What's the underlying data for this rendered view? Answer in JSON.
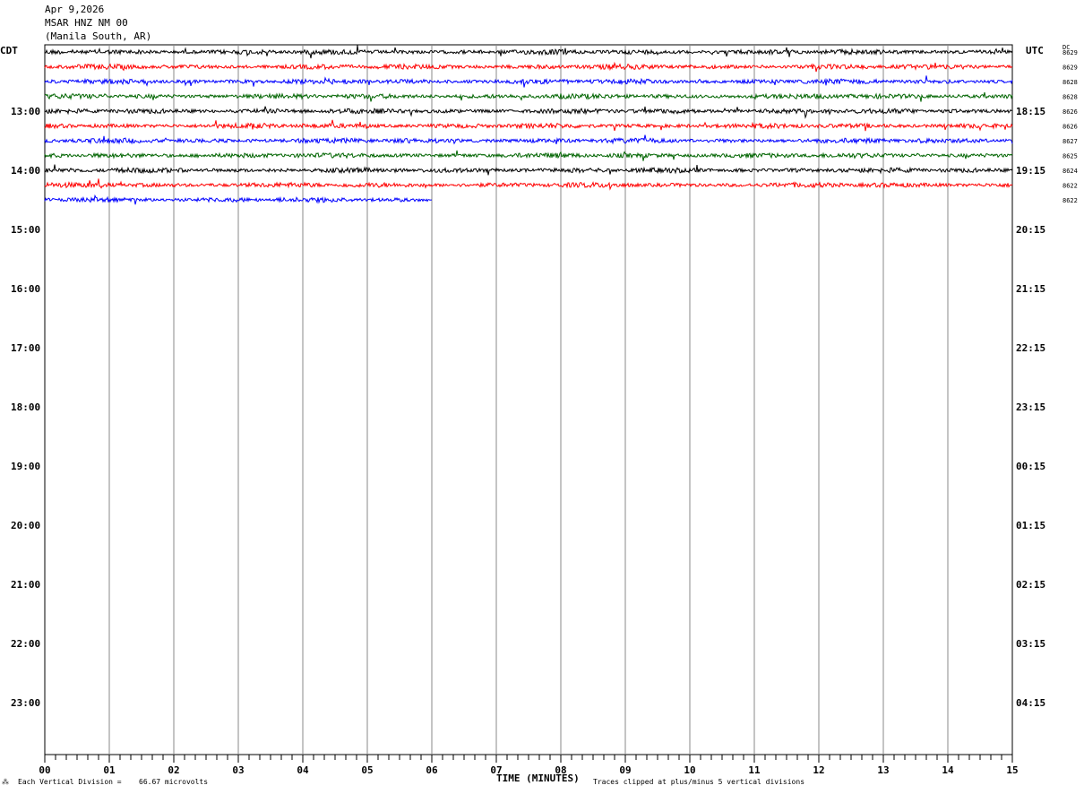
{
  "header": {
    "date": "Apr 9,2026",
    "station": "MSAR HNZ NM 00",
    "location": "(Manila South, AR)"
  },
  "left_label": "CDT",
  "right_label": "UTC",
  "dc_label": "DC",
  "chart_data": {
    "type": "line",
    "title": "",
    "xlabel": "TIME (MINUTES)",
    "xlim": [
      0,
      15
    ],
    "x_ticks": [
      "00",
      "01",
      "02",
      "03",
      "04",
      "05",
      "06",
      "07",
      "08",
      "09",
      "10",
      "11",
      "12",
      "13",
      "14",
      "15"
    ],
    "row_interval_minutes": 15,
    "total_rows": 48,
    "left_hour_labels": [
      "13:00",
      "14:00",
      "15:00",
      "16:00",
      "17:00",
      "18:00",
      "19:00",
      "20:00",
      "21:00",
      "22:00",
      "23:00"
    ],
    "right_hour_labels": [
      "18:15",
      "19:15",
      "20:15",
      "21:15",
      "22:15",
      "23:15",
      "00:15",
      "01:15",
      "02:15",
      "03:15",
      "04:15"
    ],
    "trace_colors": [
      "#000000",
      "#ff0000",
      "#0000ff",
      "#006400"
    ],
    "traces": [
      {
        "row": 0,
        "color": "#000000",
        "end_minute": 15,
        "dc_offset": "8629"
      },
      {
        "row": 1,
        "color": "#ff0000",
        "end_minute": 15,
        "dc_offset": "8629"
      },
      {
        "row": 2,
        "color": "#0000ff",
        "end_minute": 15,
        "dc_offset": "8628"
      },
      {
        "row": 3,
        "color": "#006400",
        "end_minute": 15,
        "dc_offset": "8628"
      },
      {
        "row": 4,
        "color": "#000000",
        "end_minute": 15,
        "dc_offset": "8626"
      },
      {
        "row": 5,
        "color": "#ff0000",
        "end_minute": 15,
        "dc_offset": "8626"
      },
      {
        "row": 6,
        "color": "#0000ff",
        "end_minute": 15,
        "dc_offset": "8627"
      },
      {
        "row": 7,
        "color": "#006400",
        "end_minute": 15,
        "dc_offset": "8625"
      },
      {
        "row": 8,
        "color": "#000000",
        "end_minute": 15,
        "dc_offset": "8624"
      },
      {
        "row": 9,
        "color": "#ff0000",
        "end_minute": 15,
        "dc_offset": "8622"
      },
      {
        "row": 10,
        "color": "#0000ff",
        "end_minute": 6,
        "dc_offset": "8622"
      }
    ]
  },
  "footer": {
    "scale_prefix": "Each Vertical Division =",
    "scale_value": "66.67 microvolts",
    "clip_note": "Traces clipped at plus/minus 5 vertical divisions"
  }
}
